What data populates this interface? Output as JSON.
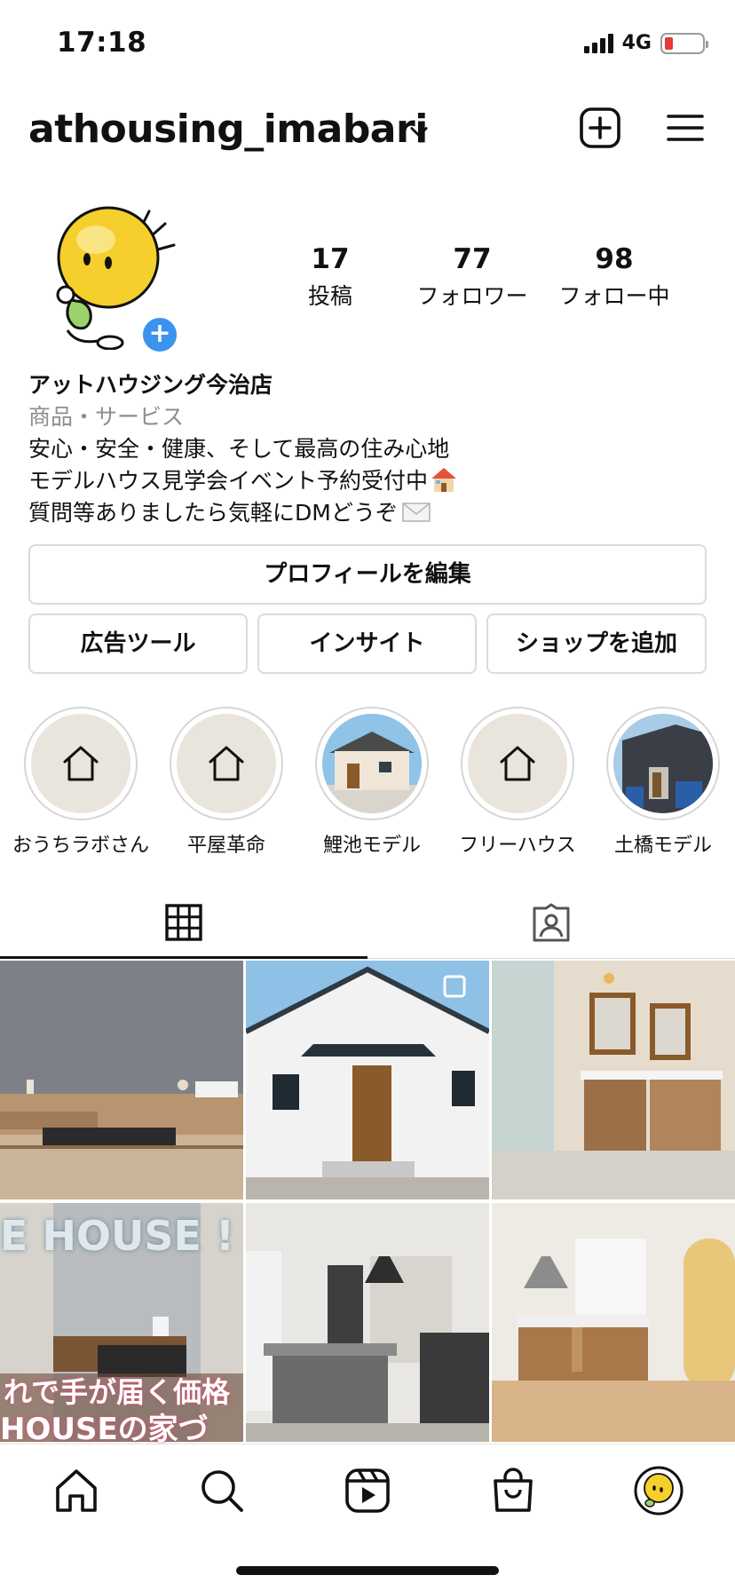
{
  "status_bar": {
    "time": "17:18",
    "network": "4G",
    "battery_color": "#e5393a"
  },
  "header": {
    "username": "athousing_imabari",
    "icons": [
      "chevron-down-icon",
      "add-post-icon",
      "menu-icon"
    ]
  },
  "profile": {
    "stats": [
      {
        "value": "17",
        "label": "投稿"
      },
      {
        "value": "77",
        "label": "フォロワー"
      },
      {
        "value": "98",
        "label": "フォロー中"
      }
    ],
    "name": "アットハウジング今治店",
    "category": "商品・サービス",
    "bio_lines": [
      "安心・安全・健康、そして最高の住み心地",
      "モデルハウス見学会イベント予約受付中",
      "質問等ありましたら気軽にDMどうぞ"
    ],
    "add_story_symbol": "+"
  },
  "buttons": {
    "edit_profile": "プロフィールを編集",
    "ad_tools": "広告ツール",
    "insights": "インサイト",
    "add_shop": "ショップを追加"
  },
  "highlights": [
    {
      "label": "おうちラボさん",
      "icon": "house-icon"
    },
    {
      "label": "平屋革命",
      "icon": "house-icon"
    },
    {
      "label": "鯉池モデル",
      "icon": "photo"
    },
    {
      "label": "フリーハウス",
      "icon": "house-icon"
    },
    {
      "label": "土橋モデル",
      "icon": "photo"
    }
  ],
  "tabs": [
    {
      "name": "grid",
      "icon": "grid-icon",
      "active": true
    },
    {
      "name": "tagged",
      "icon": "tagged-icon",
      "active": false
    }
  ],
  "posts": {
    "overlay_text": {
      "top": "E HOUSE !",
      "middle": "れで手が届く価格",
      "bottom": " HOUSEの家づ"
    }
  },
  "bottom_nav": [
    "home-icon",
    "search-icon",
    "reels-icon",
    "shop-icon",
    "profile-avatar"
  ],
  "colors": {
    "accent_blue": "#3b93f0",
    "border": "#dbdbdb",
    "muted": "#8e8e8e"
  }
}
